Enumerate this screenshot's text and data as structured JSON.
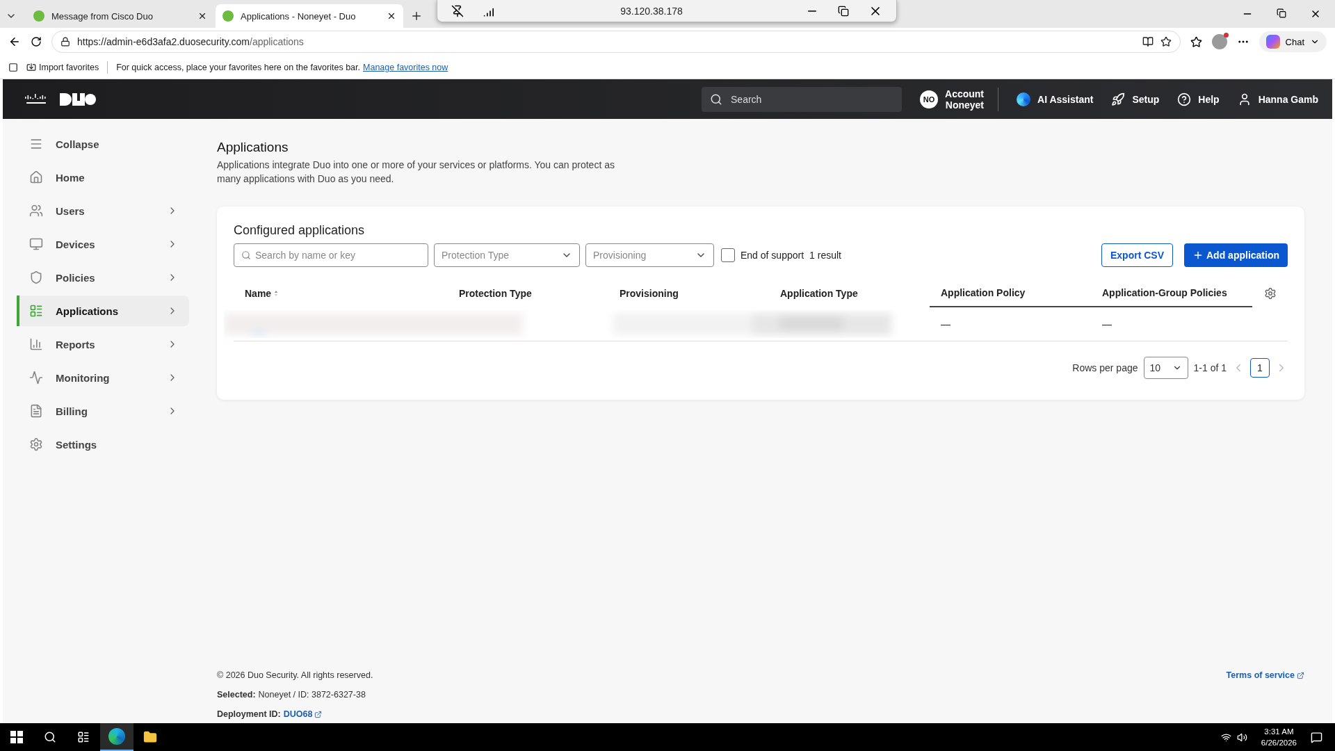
{
  "browser": {
    "tabs": [
      {
        "title": "Message from Cisco Duo",
        "selected": false
      },
      {
        "title": "Applications - Noneyet - Duo",
        "selected": true
      }
    ],
    "remote_bar": {
      "address": "93.120.38.178"
    },
    "url": {
      "host": "https://admin-e6d3afa2.duosecurity.com",
      "path": "/applications"
    },
    "chat": "Chat",
    "favorites": {
      "import": "Import favorites",
      "message": "For quick access, place your favorites here on the favorites bar.",
      "link": "Manage favorites now"
    }
  },
  "header": {
    "search_placeholder": "Search",
    "account_badge": "NO",
    "account_lines": [
      "Account",
      "Noneyet"
    ],
    "ai": "AI Assistant",
    "setup": "Setup",
    "help": "Help",
    "user": "Hanna Gamb"
  },
  "sidebar": {
    "items": [
      {
        "kind": "collapse",
        "label": "Collapse",
        "selected": false
      },
      {
        "kind": "home",
        "label": "Home",
        "selected": false
      },
      {
        "kind": "users",
        "label": "Users",
        "selected": false,
        "expandable": true
      },
      {
        "kind": "devices",
        "label": "Devices",
        "selected": false,
        "expandable": true
      },
      {
        "kind": "policies",
        "label": "Policies",
        "selected": false,
        "expandable": true
      },
      {
        "kind": "applications",
        "label": "Applications",
        "selected": true,
        "expandable": true
      },
      {
        "kind": "reports",
        "label": "Reports",
        "selected": false,
        "expandable": true
      },
      {
        "kind": "monitoring",
        "label": "Monitoring",
        "selected": false,
        "expandable": true
      },
      {
        "kind": "billing",
        "label": "Billing",
        "selected": false,
        "expandable": true
      },
      {
        "kind": "settings",
        "label": "Settings",
        "selected": false
      }
    ]
  },
  "page": {
    "title": "Applications",
    "description": "Applications integrate Duo into one or more of your services or platforms. You can protect as many applications with Duo as you need."
  },
  "card": {
    "title": "Configured applications",
    "search_placeholder": "Search by name or key",
    "filters": [
      {
        "placeholder": "Protection Type"
      },
      {
        "placeholder": "Provisioning"
      }
    ],
    "end_of_support": {
      "label": "End of support",
      "checked": false
    },
    "result_count": "1 result",
    "export": "Export CSV",
    "add": "Add application",
    "table": {
      "columns": [
        "Name",
        "Protection Type",
        "Provisioning",
        "Application Type",
        "Application Policy",
        "Application-Group Policies"
      ],
      "rows": [
        {
          "application_policy": "—",
          "group_policies": "—"
        }
      ]
    },
    "pagination": {
      "rows_label": "Rows per page",
      "rows_value": "10",
      "range": "1-1 of 1",
      "pages": [
        {
          "label": "1",
          "selected": true
        }
      ]
    }
  },
  "footer": {
    "copyright": "© 2026 Duo Security. All rights reserved.",
    "terms": "Terms of service",
    "selected_label": "Selected:",
    "selected_value": "Noneyet / ID: 3872-6327-38",
    "deployment_label": "Deployment ID:",
    "deployment_value": "DUO68"
  },
  "taskbar": {
    "time": "3:31 AM",
    "date": "6/26/2026"
  }
}
